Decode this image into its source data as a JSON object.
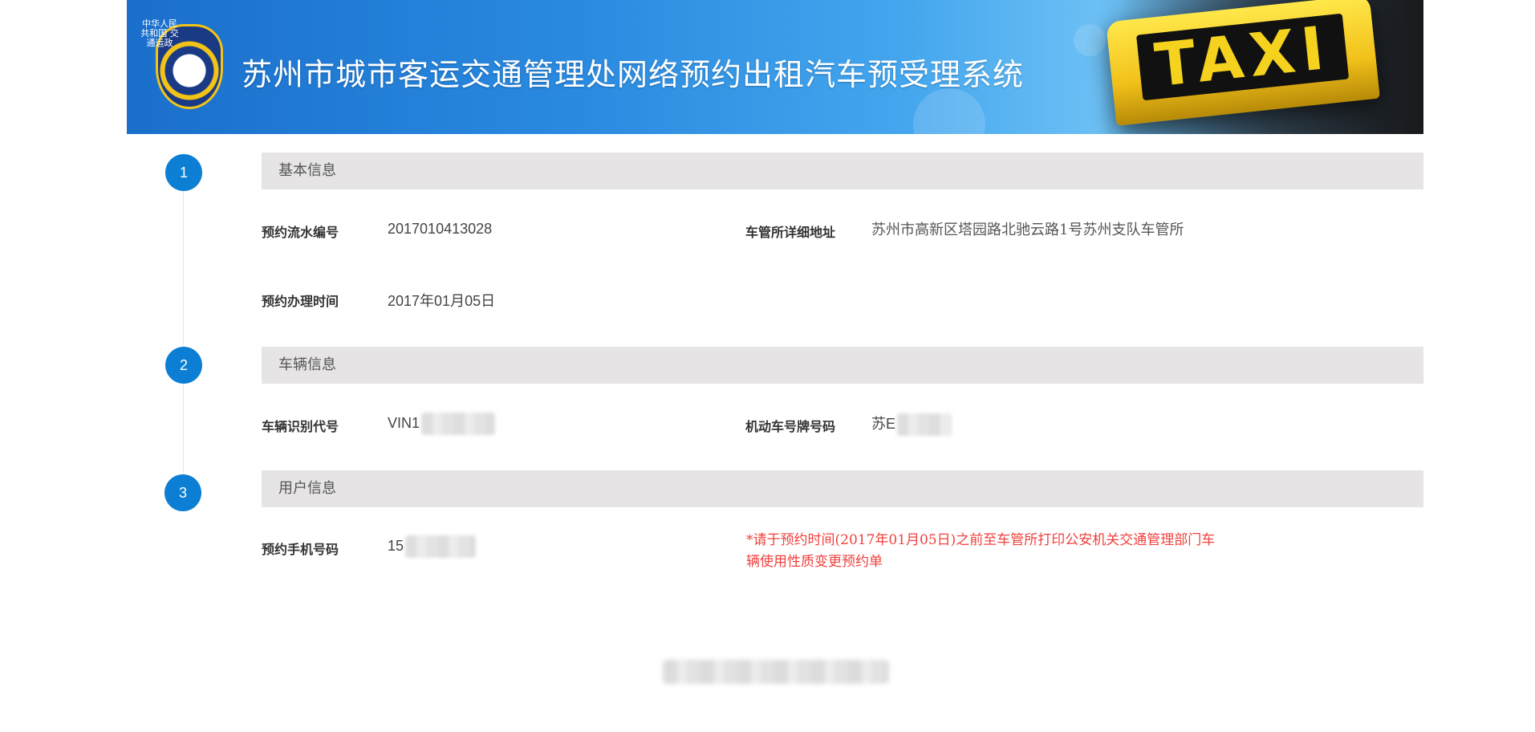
{
  "header": {
    "title": "苏州市城市客运交通管理处网络预约出租汽车预受理系统",
    "badge_text": "中华人民共和国 交通运政",
    "taxi_sign_text": "TAXI"
  },
  "steps": [
    {
      "number": "1",
      "title": "基本信息"
    },
    {
      "number": "2",
      "title": "车辆信息"
    },
    {
      "number": "3",
      "title": "用户信息"
    }
  ],
  "basic_info": {
    "serial_label": "预约流水编号",
    "serial_value": "2017010413028",
    "address_label": "车管所详细地址",
    "address_value": "苏州市高新区塔园路北驰云路1号苏州支队车管所",
    "time_label": "预约办理时间",
    "time_value": "2017年01月05日"
  },
  "vehicle_info": {
    "vin_label": "车辆识别代号",
    "vin_value": "VIN1",
    "plate_label": "机动车号牌号码",
    "plate_value": "苏E"
  },
  "user_info": {
    "phone_label": "预约手机号码",
    "phone_value": "15"
  },
  "notice": "*请于预约时间(2017年01月05日)之前至车管所打印公安机关交通管理部门车辆使用性质变更预约单",
  "colors": {
    "accent": "#0c7fd4",
    "section_bg": "#e6e4e5",
    "notice": "#f0403d"
  }
}
